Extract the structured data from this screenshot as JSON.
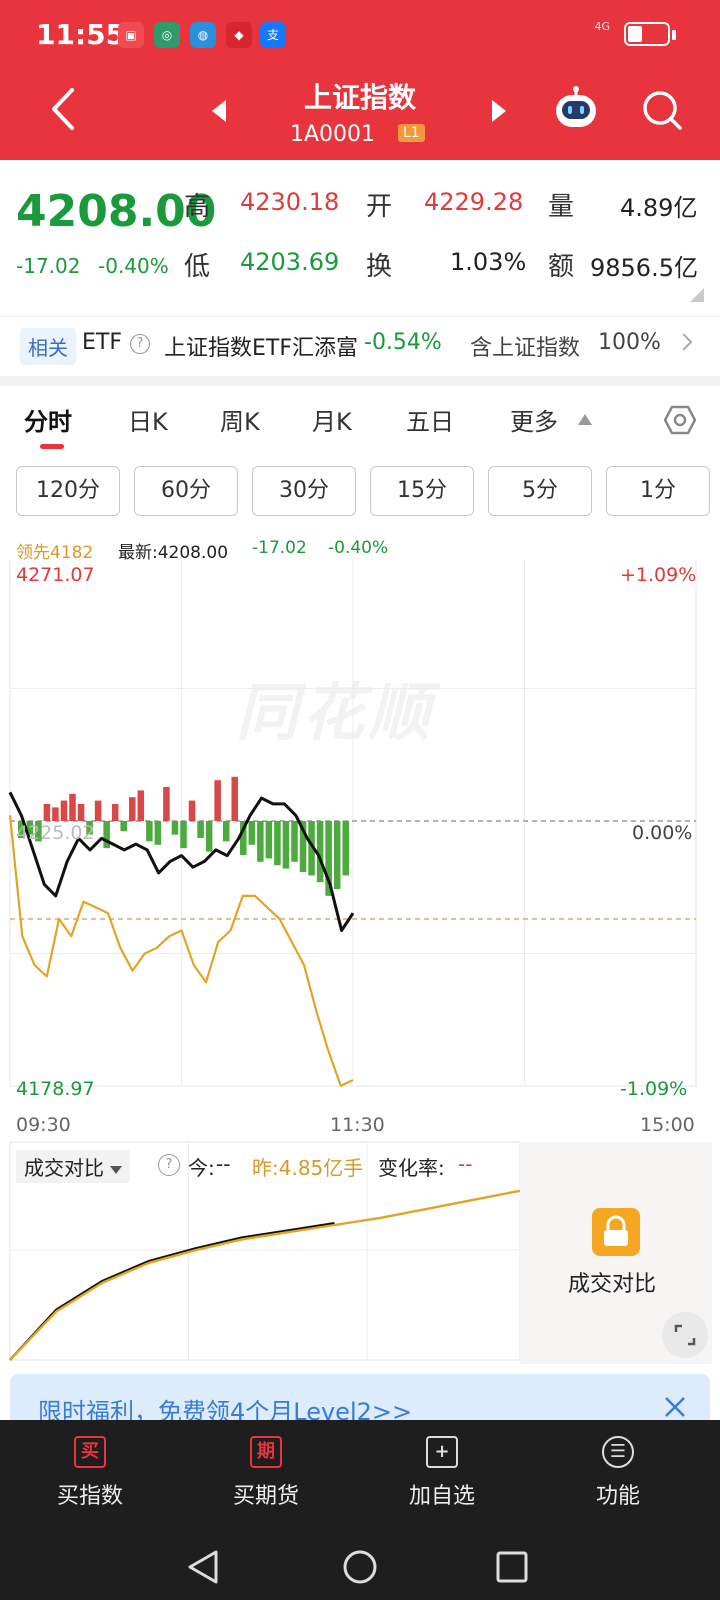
{
  "status_bar": {
    "time": "11:55",
    "network": "4G"
  },
  "header": {
    "title": "上证指数",
    "code": "1A0001",
    "level_badge": "L1"
  },
  "quote": {
    "price": "4208.00",
    "change": "-17.02",
    "change_pct": "-0.40%",
    "high_label": "高",
    "high": "4230.18",
    "open_label": "开",
    "open": "4229.28",
    "volume_label": "量",
    "volume": "4.89亿",
    "low_label": "低",
    "low": "4203.69",
    "turnover_label": "换",
    "turnover": "1.03%",
    "amount_label": "额",
    "amount": "9856.5亿"
  },
  "etf": {
    "tag": "相关",
    "label": "ETF",
    "name": "上证指数ETF汇添富",
    "change": "-0.54%",
    "holding_label": "含上证指数",
    "holding": "100%"
  },
  "tabs": [
    "分时",
    "日K",
    "周K",
    "月K",
    "五日",
    "更多"
  ],
  "periods": [
    "120分",
    "60分",
    "30分",
    "15分",
    "5分",
    "1分"
  ],
  "chart_info": {
    "lead_label": "领先4182",
    "latest_label": "最新:4208.00",
    "change": "-17.02",
    "change_pct": "-0.40%"
  },
  "chart_data": {
    "type": "line",
    "y_top": "4271.07",
    "y_bottom": "4178.97",
    "y_mid": "4225.02",
    "pct_top": "+1.09%",
    "pct_mid": "0.00%",
    "pct_bottom": "-1.09%",
    "x_labels": [
      "09:30",
      "11:30",
      "15:00"
    ],
    "ylim": [
      4178.97,
      4271.07
    ],
    "series": [
      {
        "values": [
          4230,
          4226,
          4220,
          4214,
          4212,
          4218,
          4222,
          4220,
          4222,
          4221,
          4220,
          4221,
          4220,
          4216,
          4218,
          4219,
          4217,
          4218,
          4220,
          4219,
          4222,
          4226,
          4229,
          4228,
          4228,
          4226,
          4222,
          4219,
          4214,
          4206,
          4209
        ],
        "color": "#111111"
      },
      {
        "values": [
          4226,
          4205,
          4200,
          4198,
          4208,
          4205,
          4211,
          4210,
          4209,
          4203,
          4199,
          4202,
          4203,
          4205,
          4206,
          4200,
          4197,
          4204,
          4206,
          4212,
          4212,
          4210,
          4208,
          4204,
          4200,
          4192,
          4185,
          4179,
          4180
        ],
        "color": "#e2a424"
      }
    ],
    "volume_bars": [
      -5,
      -4,
      -6,
      5,
      4,
      6,
      8,
      5,
      -4,
      6,
      -8,
      5,
      -3,
      7,
      9,
      -6,
      -7,
      10,
      -4,
      -8,
      6,
      -5,
      -9,
      12,
      -6,
      13,
      -10,
      -7,
      -12,
      -11,
      -13,
      -14,
      -12,
      -15,
      -16,
      -18,
      -22,
      -20,
      -16
    ]
  },
  "volume_compare": {
    "dropdown": "成交对比",
    "today_label": "今:",
    "today_value": "--",
    "yesterday": "昨:4.85亿手",
    "rate_label": "变化率:",
    "rate_value": "--",
    "lock_label": "成交对比",
    "series": [
      {
        "color": "#111111",
        "values": [
          0,
          0.28,
          0.44,
          0.55,
          0.62,
          0.68,
          0.72,
          0.76
        ]
      },
      {
        "color": "#e2a424",
        "values": [
          0,
          0.27,
          0.43,
          0.54,
          0.61,
          0.67,
          0.71,
          0.75,
          0.79,
          0.84,
          0.89,
          0.94
        ]
      }
    ]
  },
  "promo": {
    "text": "限时福利，免费领4个月Level2>>"
  },
  "bottom_nav": [
    {
      "icon_char": "买",
      "label": "买指数"
    },
    {
      "icon_char": "期",
      "label": "买期货"
    },
    {
      "icon_char": "+",
      "label": "加自选"
    },
    {
      "icon_char": "☰",
      "label": "功能"
    }
  ]
}
